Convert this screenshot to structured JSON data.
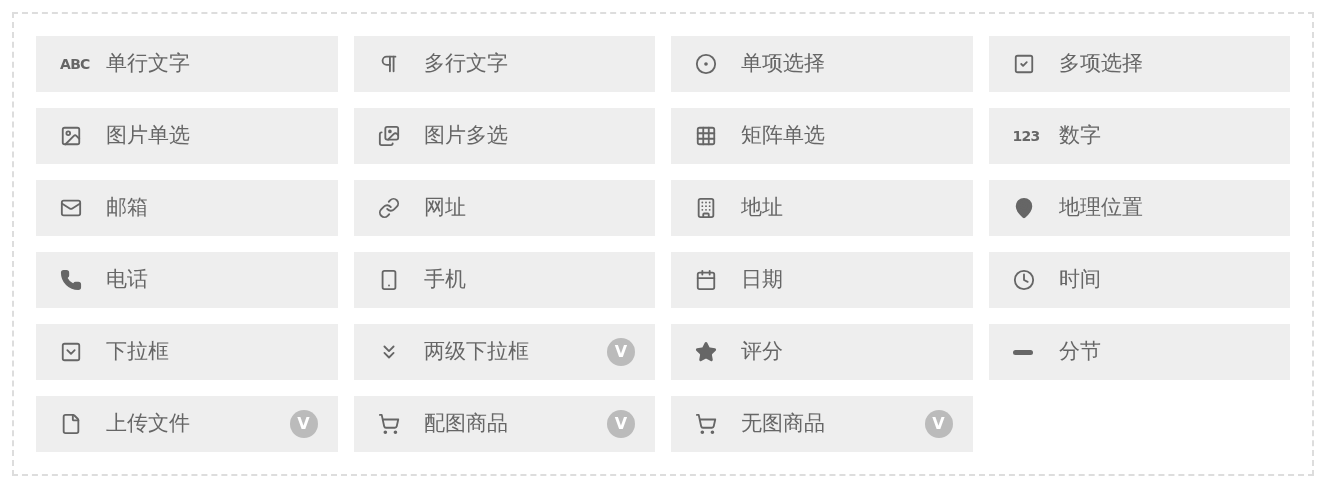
{
  "fields": [
    {
      "kind": "glyph",
      "glyph": "ABC",
      "label": "单行文字"
    },
    {
      "kind": "paragraph",
      "label": "多行文字"
    },
    {
      "kind": "radio",
      "label": "单项选择"
    },
    {
      "kind": "checkbox",
      "label": "多项选择"
    },
    {
      "kind": "image-single",
      "label": "图片单选"
    },
    {
      "kind": "image-multi",
      "label": "图片多选"
    },
    {
      "kind": "matrix",
      "label": "矩阵单选"
    },
    {
      "kind": "glyph",
      "glyph": "123",
      "label": "数字"
    },
    {
      "kind": "mail",
      "label": "邮箱"
    },
    {
      "kind": "link",
      "label": "网址"
    },
    {
      "kind": "building",
      "label": "地址"
    },
    {
      "kind": "pin",
      "label": "地理位置"
    },
    {
      "kind": "phone",
      "label": "电话"
    },
    {
      "kind": "mobile",
      "label": "手机"
    },
    {
      "kind": "calendar",
      "label": "日期"
    },
    {
      "kind": "clock",
      "label": "时间"
    },
    {
      "kind": "dropdown",
      "label": "下拉框"
    },
    {
      "kind": "chevrons",
      "label": "两级下拉框",
      "badge": "V"
    },
    {
      "kind": "star",
      "label": "评分"
    },
    {
      "kind": "minus",
      "label": "分节"
    },
    {
      "kind": "file",
      "label": "上传文件",
      "badge": "V"
    },
    {
      "kind": "cart",
      "label": "配图商品",
      "badge": "V"
    },
    {
      "kind": "cart-plain",
      "label": "无图商品",
      "badge": "V"
    }
  ]
}
